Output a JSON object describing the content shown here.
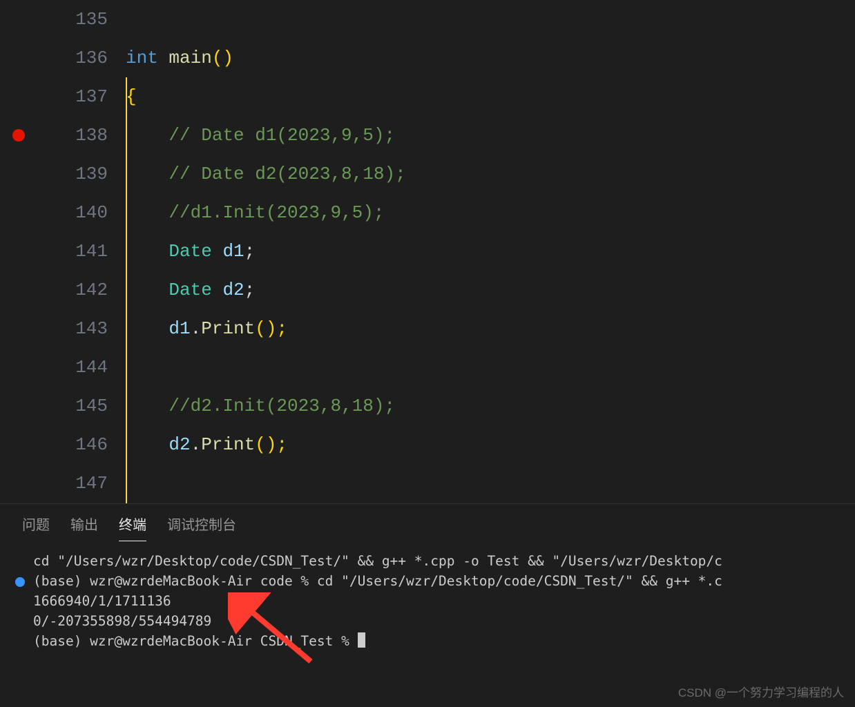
{
  "gutter": {
    "start": 135,
    "end": 147,
    "breakpoint_line": 138
  },
  "code": {
    "l135": "",
    "l136_kw": "int",
    "l136_fn": " main",
    "l136_pn": "()",
    "l137": "{",
    "l138": "    // Date d1(2023,9,5);",
    "l139": "    // Date d2(2023,8,18);",
    "l140": "    //d1.Init(2023,9,5);",
    "l141_ind": "    ",
    "l141_type": "Date",
    "l141_sp": " ",
    "l141_var": "d1",
    "l141_semi": ";",
    "l142_type": "Date",
    "l142_var": "d2",
    "l143_var": "d1",
    "l143_dot": ".",
    "l143_fn": "Print",
    "l143_call": "();",
    "l144": "",
    "l145": "    //d2.Init(2023,8,18);",
    "l146_var": "d2",
    "l146_fn": "Print",
    "l147": ""
  },
  "tabs": {
    "problems": "问题",
    "output": "输出",
    "terminal": "终端",
    "debug": "调试控制台"
  },
  "terminal": {
    "line1": "cd \"/Users/wzr/Desktop/code/CSDN_Test/\" && g++ *.cpp -o Test && \"/Users/wzr/Desktop/c",
    "line2": "(base) wzr@wzrdeMacBook-Air code % cd \"/Users/wzr/Desktop/code/CSDN_Test/\" && g++ *.c",
    "line3": "1666940/1/1711136",
    "line4": "0/-207355898/554494789",
    "line5a": "(base) wzr@wzrdeMacBook-Air",
    "line5b": "CSDN_Test % "
  },
  "watermark": "CSDN @一个努力学习编程的人"
}
